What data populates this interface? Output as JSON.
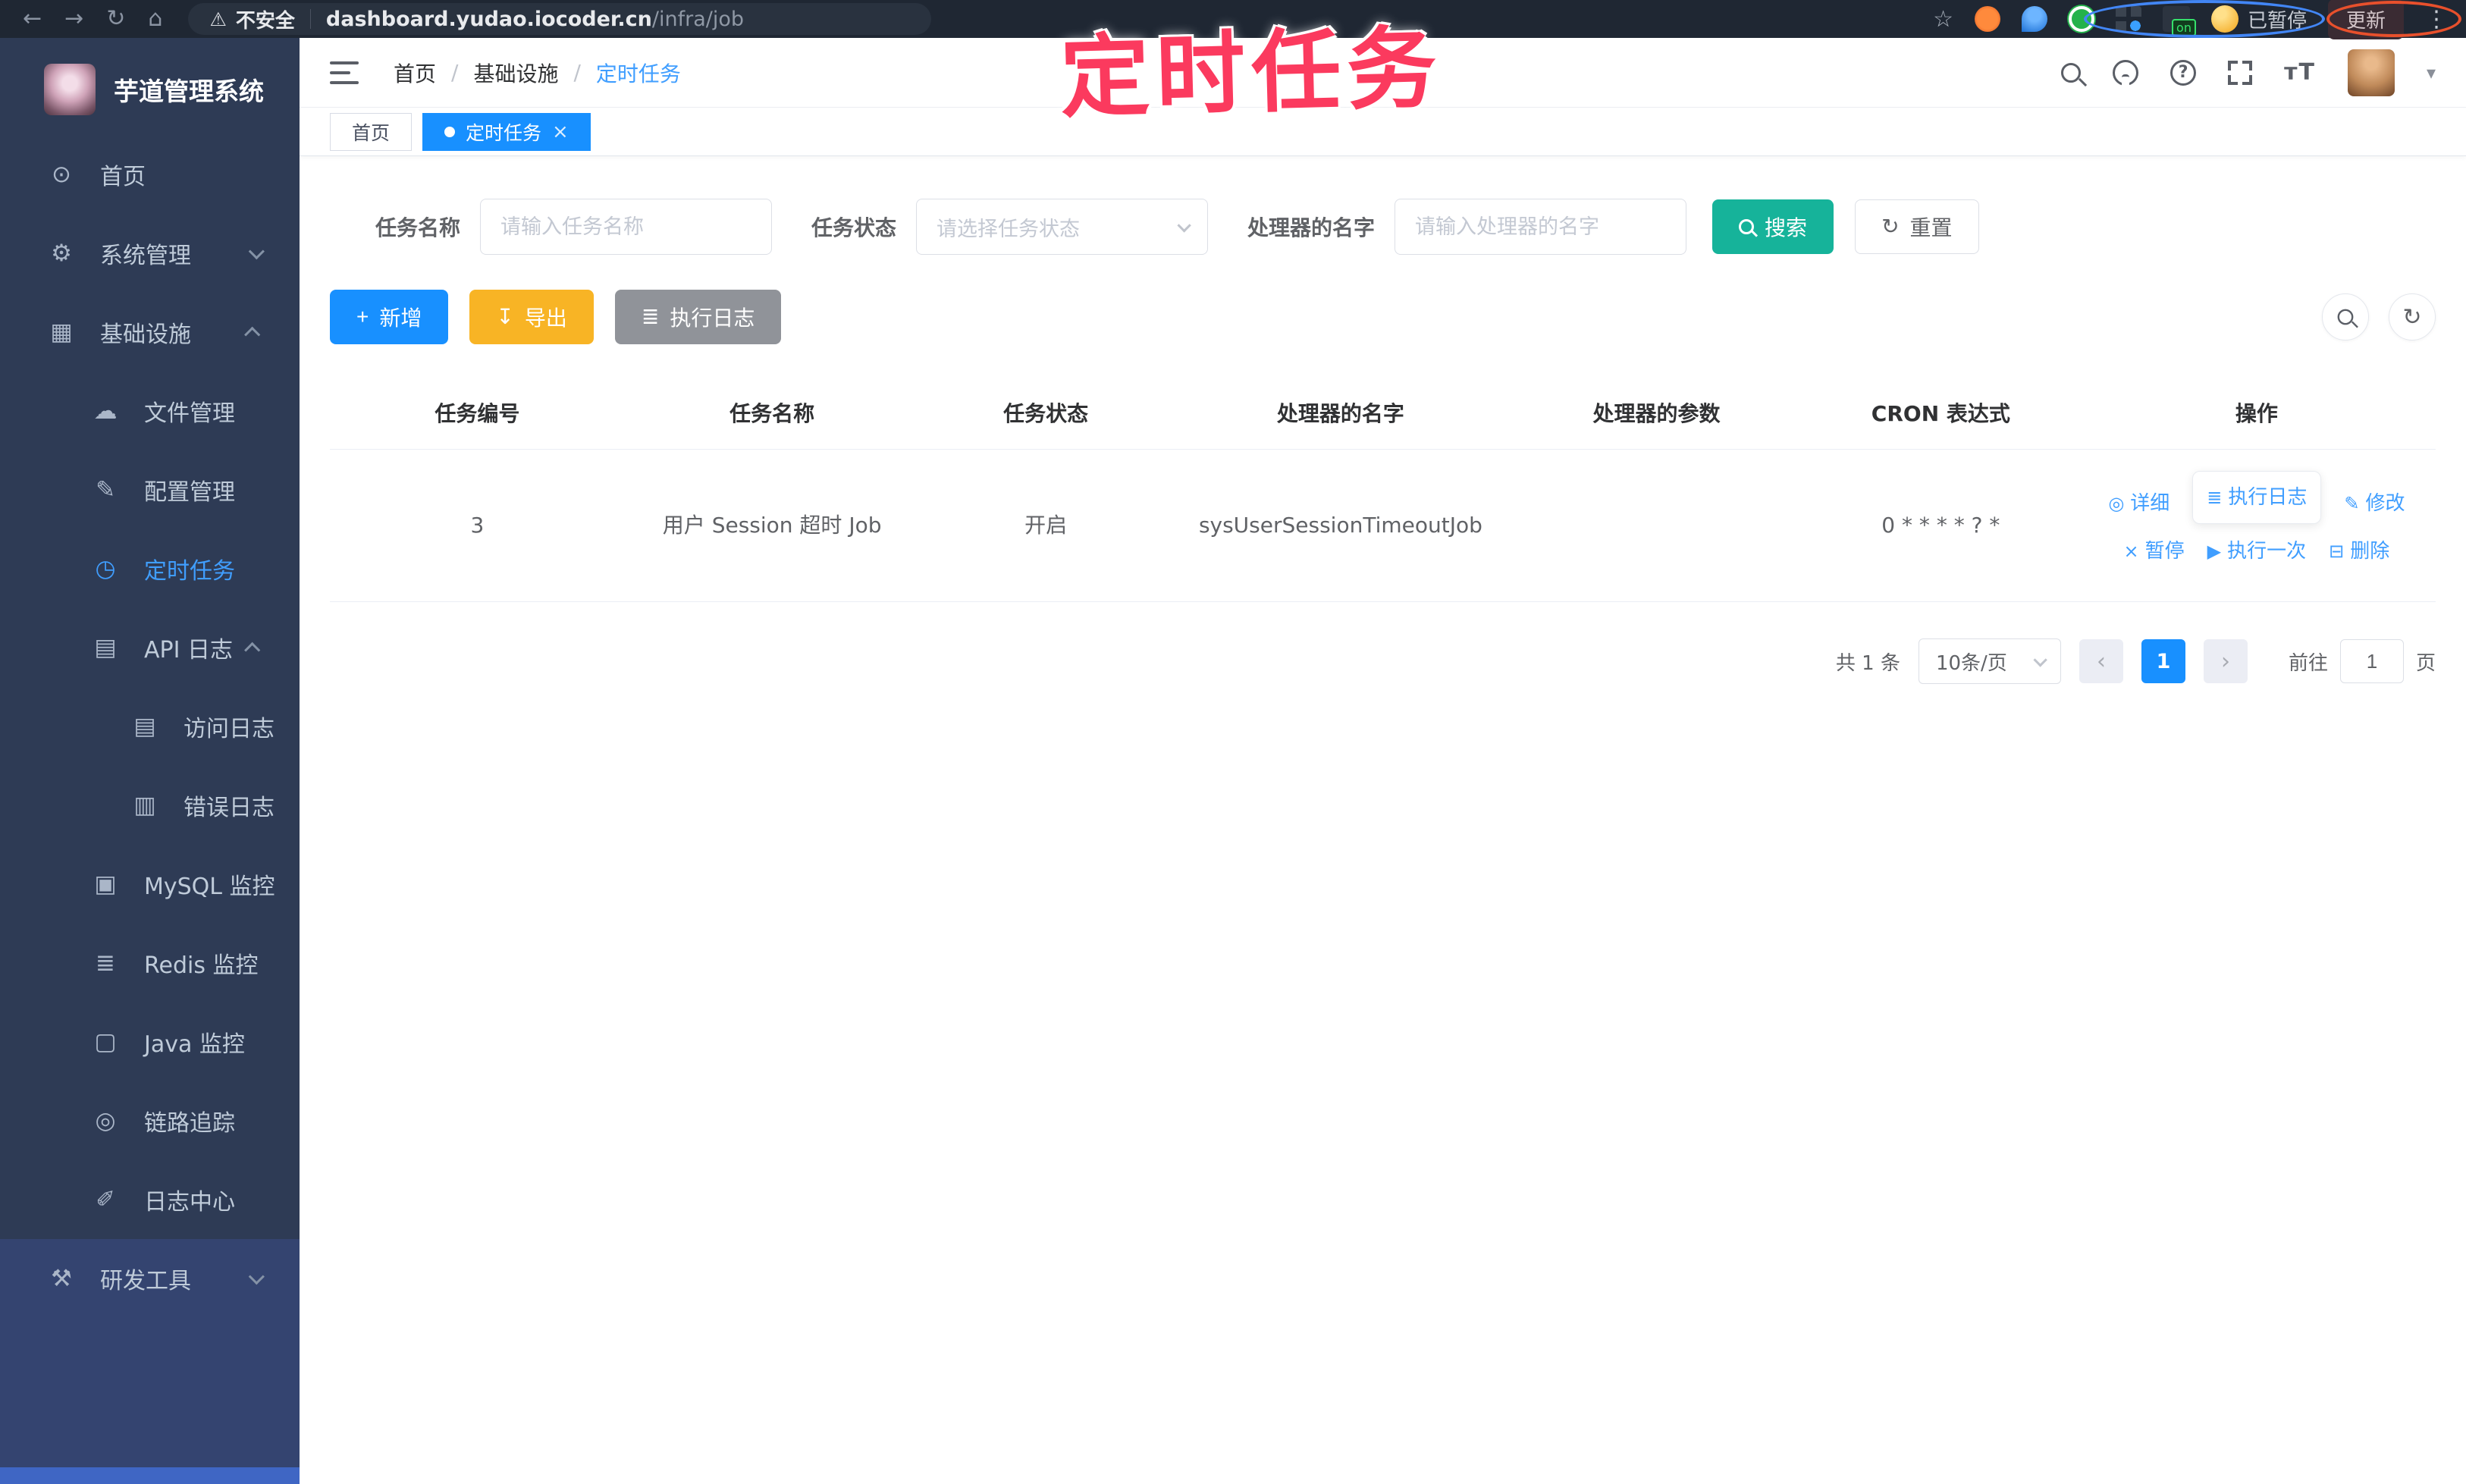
{
  "colors": {
    "accent_blue": "#1890ff",
    "link_blue": "#409eff",
    "search_teal": "#16b39a",
    "export_yellow": "#f8b425",
    "exec_gray": "#909399",
    "annotation_pink": "#fb3a5e",
    "sidebar_bg": "#2e3b55"
  },
  "annotation": {
    "title": "定时任务"
  },
  "browser": {
    "security_label": "不安全",
    "url_domain": "dashboard.yudao.iocoder.cn",
    "url_path": "/infra/job",
    "sync_paused_label": "已暂停",
    "update_button_label": "更新",
    "extension_badge": "on"
  },
  "sidebar": {
    "app_title": "芋道管理系统",
    "items": [
      {
        "label": "首页",
        "glyph": "⊙",
        "icon": "gauge-icon"
      },
      {
        "label": "系统管理",
        "glyph": "⚙",
        "icon": "gear-icon"
      },
      {
        "label": "基础设施",
        "glyph": "▦",
        "icon": "infrastructure-icon"
      },
      {
        "label": "文件管理",
        "glyph": "☁",
        "icon": "cloud-upload-icon"
      },
      {
        "label": "配置管理",
        "glyph": "✎",
        "icon": "edit-icon"
      },
      {
        "label": "定时任务",
        "glyph": "◷",
        "icon": "timer-icon"
      },
      {
        "label": "API 日志",
        "glyph": "▤",
        "icon": "log-icon"
      },
      {
        "label": "访问日志",
        "glyph": "▤",
        "icon": "access-log-icon"
      },
      {
        "label": "错误日志",
        "glyph": "▥",
        "icon": "error-log-icon"
      },
      {
        "label": "MySQL 监控",
        "glyph": "▣",
        "icon": "mysql-monitor-icon"
      },
      {
        "label": "Redis 监控",
        "glyph": "≣",
        "icon": "redis-monitor-icon"
      },
      {
        "label": "Java 监控",
        "glyph": "▢",
        "icon": "java-monitor-icon"
      },
      {
        "label": "链路追踪",
        "glyph": "◎",
        "icon": "trace-icon"
      },
      {
        "label": "日志中心",
        "glyph": "✐",
        "icon": "log-center-icon"
      },
      {
        "label": "研发工具",
        "glyph": "⚒",
        "icon": "toolbox-icon"
      }
    ]
  },
  "nav": {
    "breadcrumb": [
      "首页",
      "基础设施",
      "定时任务"
    ]
  },
  "tabs": [
    {
      "label": "首页"
    },
    {
      "label": "定时任务"
    }
  ],
  "filters": {
    "fields": [
      {
        "label": "任务名称",
        "placeholder": "请输入任务名称"
      },
      {
        "label": "任务状态",
        "placeholder": "请选择任务状态"
      },
      {
        "label": "处理器的名字",
        "placeholder": "请输入处理器的名字"
      }
    ],
    "search_label": "搜索",
    "reset_label": "重置"
  },
  "toolbar": {
    "add_label": "新增",
    "export_label": "导出",
    "exec_log_label": "执行日志"
  },
  "table": {
    "columns": [
      "任务编号",
      "任务名称",
      "任务状态",
      "处理器的名字",
      "处理器的参数",
      "CRON 表达式",
      "操作"
    ],
    "rows": [
      {
        "id": "3",
        "name": "用户 Session 超时 Job",
        "status": "开启",
        "handler": "sysUserSessionTimeoutJob",
        "param": "",
        "cron": "0 * * * * ? *"
      }
    ],
    "row_actions": [
      "详细",
      "执行日志",
      "修改",
      "暂停",
      "执行一次",
      "删除"
    ]
  },
  "pagination": {
    "total_label": "共 1 条",
    "page_size_label": "10条/页",
    "page": "1",
    "goto_label": "前往",
    "goto_value": "1",
    "page_unit": "页"
  }
}
